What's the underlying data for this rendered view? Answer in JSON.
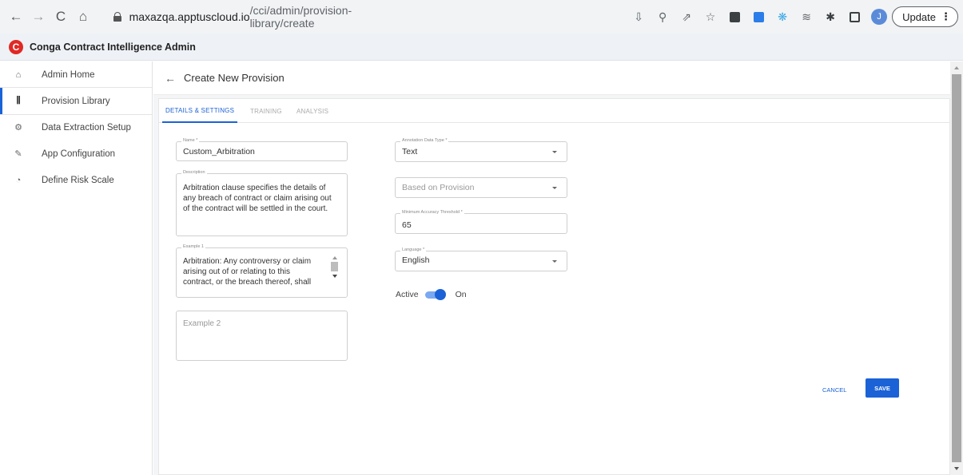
{
  "browser": {
    "url_host": "maxazqa.apptuscloud.io",
    "url_path": "/cci/admin/provision-library/create",
    "profile_initial": "J",
    "update_label": "Update",
    "nav_icons": [
      "back-arrow-icon",
      "forward-arrow-icon",
      "reload-icon",
      "home-icon"
    ]
  },
  "app": {
    "logo_letter": "C",
    "title": "Conga Contract Intelligence Admin",
    "brand_color": "#e02926",
    "accent_color": "#1b62d6"
  },
  "sidebar": {
    "items": [
      {
        "label": "Admin Home",
        "icon": "home-icon",
        "active": false
      },
      {
        "label": "Provision Library",
        "icon": "library-icon",
        "active": true
      },
      {
        "label": "Data Extraction Setup",
        "icon": "gear-icon",
        "active": false
      },
      {
        "label": "App Configuration",
        "icon": "wrench-icon",
        "active": false
      },
      {
        "label": "Define Risk Scale",
        "icon": "gauge-icon",
        "active": false
      }
    ]
  },
  "page": {
    "back_icon": "back-arrow-icon",
    "title": "Create New Provision"
  },
  "tabs": [
    {
      "label": "DETAILS & SETTINGS",
      "active": true
    },
    {
      "label": "TRAINING",
      "active": false
    },
    {
      "label": "ANALYSIS",
      "active": false
    }
  ],
  "form": {
    "name": {
      "label": "Name *",
      "value": "Custom_Arbitration"
    },
    "description": {
      "label": "Description",
      "lines": [
        "Arbitration clause specifies the details of",
        "any breach of contract or claim arising out",
        "of the contract will be settled in the court."
      ]
    },
    "example1": {
      "label": "Example 1",
      "lines": [
        "Arbitration:  Any controversy or claim",
        "arising out of or relating to this",
        "contract, or the breach thereof, shall"
      ]
    },
    "example2": {
      "placeholder": "Example 2"
    },
    "annotation_type": {
      "label": "Annotation Data Type *",
      "value": "Text"
    },
    "based_on": {
      "placeholder": "Based on Provision"
    },
    "accuracy": {
      "label": "Minimum Accuracy Threshold *",
      "value": "65"
    },
    "language": {
      "label": "Language *",
      "value": "English"
    },
    "active": {
      "label": "Active",
      "state_label": "On",
      "on": true
    }
  },
  "actions": {
    "cancel_label": "CANCEL",
    "save_label": "SAVE"
  }
}
